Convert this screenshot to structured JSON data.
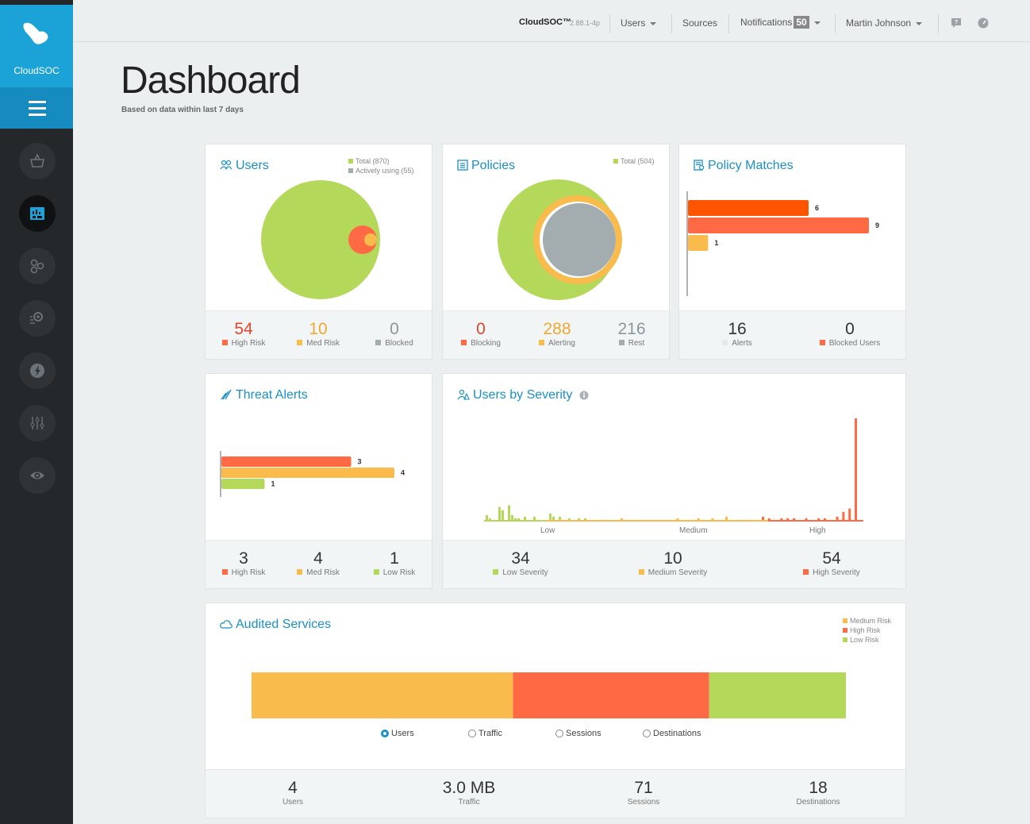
{
  "app": {
    "brand": "CloudSOC",
    "version": "2.88.1-4p"
  },
  "colors": {
    "high": "#ff6a45",
    "medium": "#f9bb4b",
    "low": "#b4d85a",
    "gray": "#a3adb0",
    "accent": "#1a8fc9"
  },
  "topbar": {
    "product": "CloudSOC™",
    "version": "2.88.1-4p",
    "users_label": "Users",
    "sources_label": "Sources",
    "notifications_label": "Notifications",
    "notifications_count": "50",
    "user_name": "Martin Johnson"
  },
  "sidebar": {
    "items": [
      {
        "icon": "basket-icon"
      },
      {
        "icon": "dashboard-icon",
        "active": true
      },
      {
        "icon": "integrations-icon"
      },
      {
        "icon": "investigate-icon"
      },
      {
        "icon": "protect-icon"
      },
      {
        "icon": "settings-sliders-icon"
      },
      {
        "icon": "eye-icon"
      }
    ]
  },
  "page": {
    "title": "Dashboard",
    "subtitle": "Based on data within last 7 days"
  },
  "users_card": {
    "title": "Users",
    "legend_total": "Total (870)",
    "legend_active": "Actively using (55)",
    "stats": [
      {
        "value": "54",
        "label": "High Risk"
      },
      {
        "value": "10",
        "label": "Med Risk"
      },
      {
        "value": "0",
        "label": "Blocked"
      }
    ]
  },
  "policies_card": {
    "title": "Policies",
    "legend_total": "Total (504)",
    "stats": [
      {
        "value": "0",
        "label": "Blocking"
      },
      {
        "value": "288",
        "label": "Alerting"
      },
      {
        "value": "216",
        "label": "Rest"
      }
    ]
  },
  "policy_matches_card": {
    "title": "Policy Matches",
    "bars": [
      {
        "value": 6
      },
      {
        "value": 9
      },
      {
        "value": 1
      }
    ],
    "bar_labels": [
      "6",
      "9",
      "1"
    ],
    "stats": [
      {
        "value": "16",
        "label": "Alerts"
      },
      {
        "value": "0",
        "label": "Blocked Users"
      }
    ]
  },
  "threat_alerts_card": {
    "title": "Threat Alerts",
    "bars": [
      {
        "value": 3
      },
      {
        "value": 4
      },
      {
        "value": 1
      }
    ],
    "bar_labels": [
      "3",
      "4",
      "1"
    ],
    "stats": [
      {
        "value": "3",
        "label": "High Risk"
      },
      {
        "value": "4",
        "label": "Med Risk"
      },
      {
        "value": "1",
        "label": "Low Risk"
      }
    ]
  },
  "users_by_severity_card": {
    "title": "Users by Severity",
    "axis_labels": [
      "Low",
      "Medium",
      "High"
    ],
    "stats": [
      {
        "value": "34",
        "label": "Low Severity"
      },
      {
        "value": "10",
        "label": "Medium Severity"
      },
      {
        "value": "54",
        "label": "High Severity"
      }
    ]
  },
  "audited_services_card": {
    "title": "Audited Services",
    "legend": [
      "Medium Risk",
      "High Risk",
      "Low Risk"
    ],
    "segments": [
      {
        "label": "Medium Risk",
        "fraction": 0.44
      },
      {
        "label": "High Risk",
        "fraction": 0.33
      },
      {
        "label": "Low Risk",
        "fraction": 0.23
      }
    ],
    "radio_options": [
      "Users",
      "Traffic",
      "Sessions",
      "Destinations"
    ],
    "selected_option": "Users",
    "stats": [
      {
        "value": "4",
        "label": "Users"
      },
      {
        "value": "3.0 MB",
        "label": "Traffic"
      },
      {
        "value": "71",
        "label": "Sessions"
      },
      {
        "value": "18",
        "label": "Destinations"
      }
    ]
  },
  "chart_data": [
    {
      "type": "bar",
      "title": "Policy Matches",
      "orientation": "horizontal",
      "categories": [
        "",
        "",
        ""
      ],
      "values": [
        6,
        9,
        1
      ],
      "colors": [
        "#ff5500",
        "#ff6a45",
        "#f9bb4b"
      ]
    },
    {
      "type": "bar",
      "title": "Threat Alerts",
      "orientation": "horizontal",
      "categories": [
        "High Risk",
        "Med Risk",
        "Low Risk"
      ],
      "values": [
        3,
        4,
        1
      ],
      "colors": [
        "#ff6a45",
        "#f9bb4b",
        "#b4d85a"
      ]
    },
    {
      "type": "bar",
      "title": "Users by Severity",
      "xlabel_ticks": [
        "Low",
        "Medium",
        "High"
      ],
      "series": [
        {
          "values": [
            3,
            1,
            0,
            0,
            8,
            6,
            0,
            9,
            3,
            1,
            1,
            0,
            2,
            0,
            0,
            2,
            0,
            0,
            0,
            0,
            4,
            2,
            0,
            2,
            0,
            0,
            1,
            0,
            0,
            1,
            0,
            1
          ]
        },
        {
          "values": [
            1,
            0,
            0,
            0,
            0,
            0,
            0,
            0,
            1,
            0,
            0,
            1,
            0,
            1,
            0,
            2,
            0,
            0,
            0,
            0,
            0
          ]
        },
        {
          "values": [
            2,
            1,
            0,
            1,
            1,
            1,
            0,
            1,
            0,
            1,
            1,
            0,
            2,
            5,
            7,
            100
          ]
        }
      ]
    },
    {
      "type": "bar",
      "title": "Audited Services",
      "orientation": "stacked-horizontal",
      "categories": [
        "Medium Risk",
        "High Risk",
        "Low Risk"
      ],
      "values": [
        0.44,
        0.33,
        0.23
      ]
    }
  ]
}
